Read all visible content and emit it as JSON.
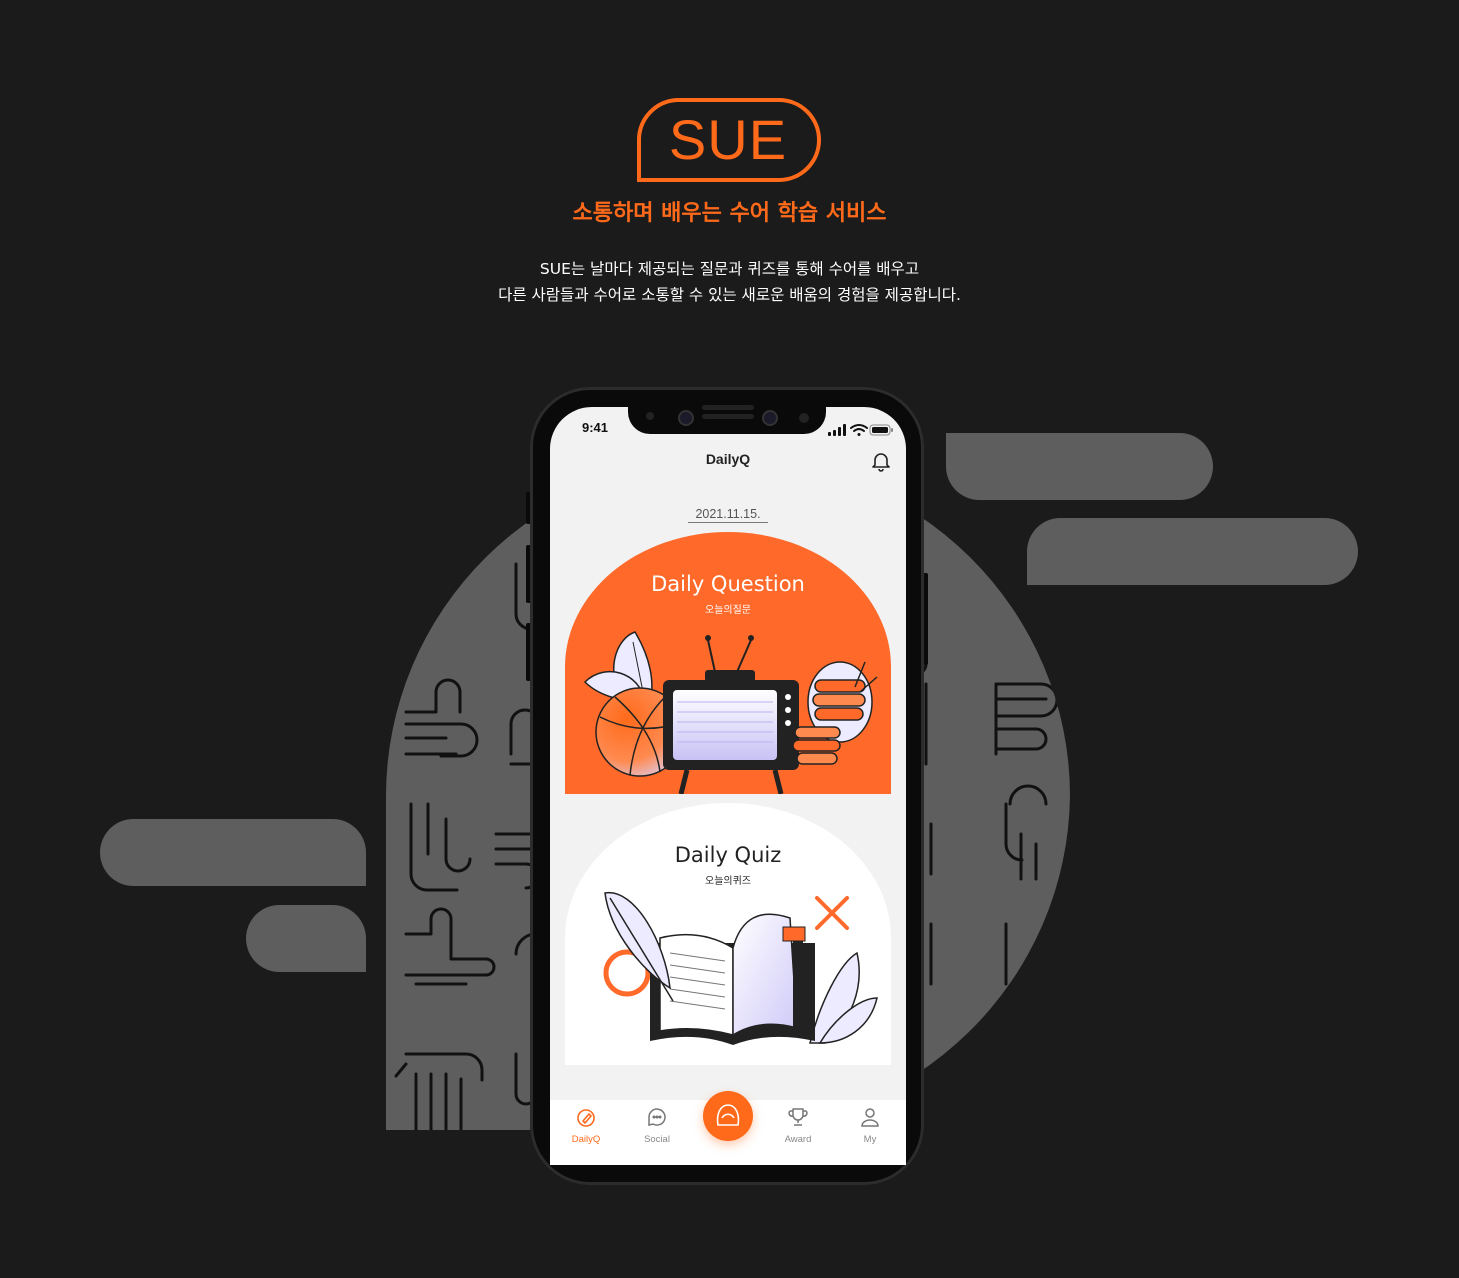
{
  "brand": {
    "logo_text": "SUE",
    "tagline": "소통하며 배우는 수어 학습 서비스",
    "description_lines": [
      "SUE는 날마다 제공되는 질문과 퀴즈를 통해 수어를 배우고",
      "다른 사람들과 수어로 소통할 수 있는 새로운 배움의 경험을 제공합니다."
    ]
  },
  "colors": {
    "accent": "#ff6a1a",
    "background": "#1b1b1b",
    "pill": "#5e5e5e",
    "screen": "#f2f2f2"
  },
  "status_bar": {
    "time": "9:41",
    "icons": [
      "signal-icon",
      "wifi-icon",
      "battery-icon"
    ]
  },
  "header": {
    "title": "DailyQ",
    "right_icon": "bell-icon"
  },
  "date": "2021.11.15.",
  "cards": {
    "question": {
      "title": "Daily Question",
      "subtitle": "오늘의질문"
    },
    "quiz": {
      "title": "Daily Quiz",
      "subtitle": "오늘의퀴즈"
    }
  },
  "tabbar": {
    "items": [
      {
        "label": "DailyQ",
        "icon": "pen-icon",
        "active": true
      },
      {
        "label": "Social",
        "icon": "chat-icon",
        "active": false
      },
      {
        "label": "",
        "icon": "face-icon",
        "active": false
      },
      {
        "label": "Award",
        "icon": "trophy-icon",
        "active": false
      },
      {
        "label": "My",
        "icon": "person-icon",
        "active": false
      }
    ]
  }
}
